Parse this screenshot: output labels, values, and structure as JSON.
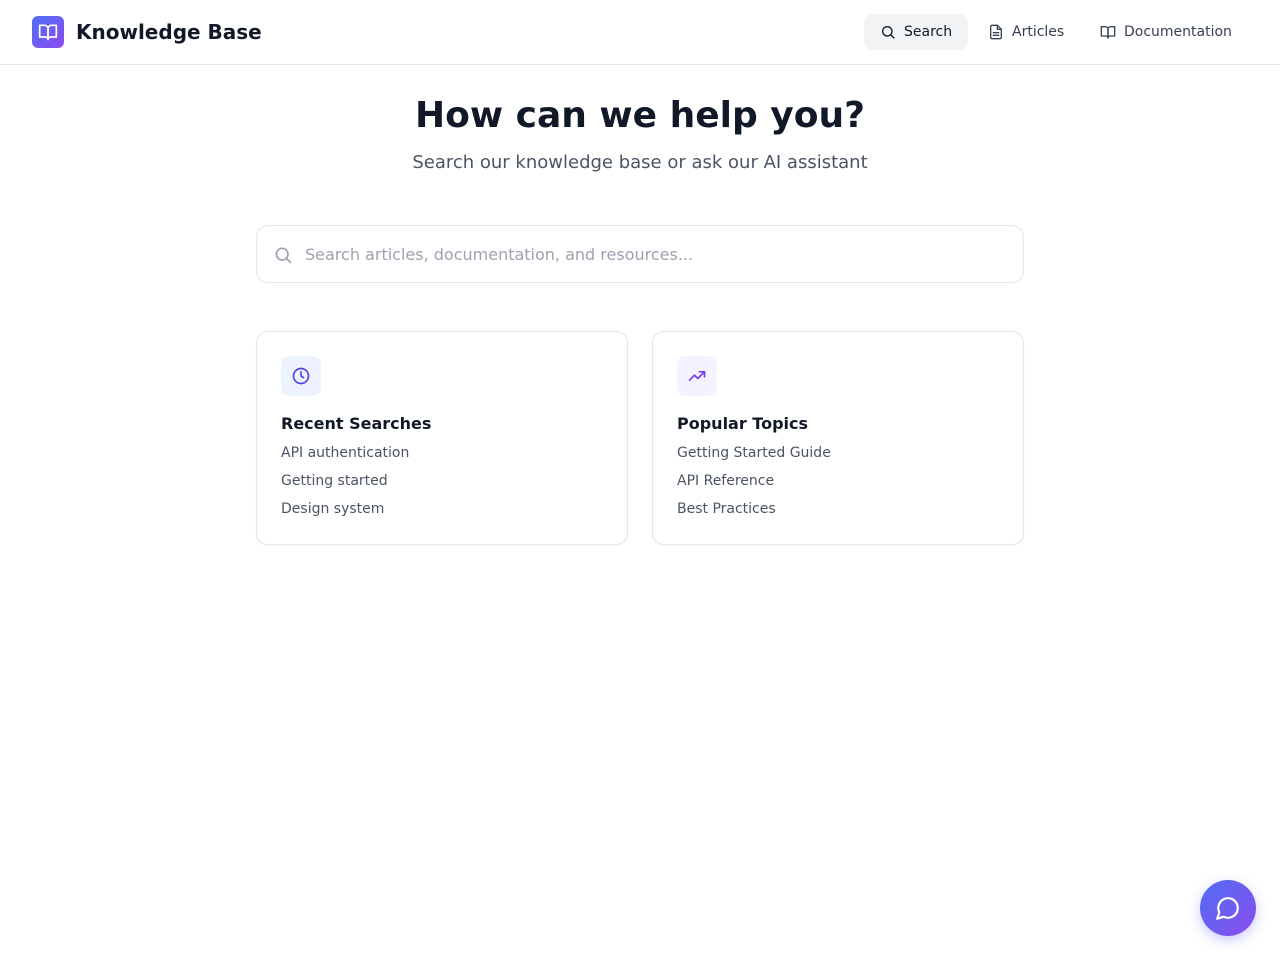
{
  "app": {
    "title": "Knowledge Base",
    "logo_icon": "book-open-icon",
    "accent_gradient": [
      "#4f6ef2",
      "#8b4cf0"
    ]
  },
  "nav": [
    {
      "label": "Search",
      "icon": "search-icon",
      "active": true
    },
    {
      "label": "Articles",
      "icon": "document-icon",
      "active": false
    },
    {
      "label": "Documentation",
      "icon": "book-icon",
      "active": false
    }
  ],
  "hero": {
    "title": "How can we help you?",
    "subtitle": "Search our knowledge base or ask our AI assistant"
  },
  "search": {
    "placeholder": "Search articles, documentation, and resources...",
    "value": ""
  },
  "cards": {
    "recent": {
      "icon": "clock-icon",
      "title": "Recent Searches",
      "items": [
        "API authentication",
        "Getting started",
        "Design system"
      ]
    },
    "popular": {
      "icon": "trending-up-icon",
      "title": "Popular Topics",
      "items": [
        "Getting Started Guide",
        "API Reference",
        "Best Practices"
      ]
    }
  },
  "chat_button": {
    "icon": "chat-bubble-icon"
  }
}
